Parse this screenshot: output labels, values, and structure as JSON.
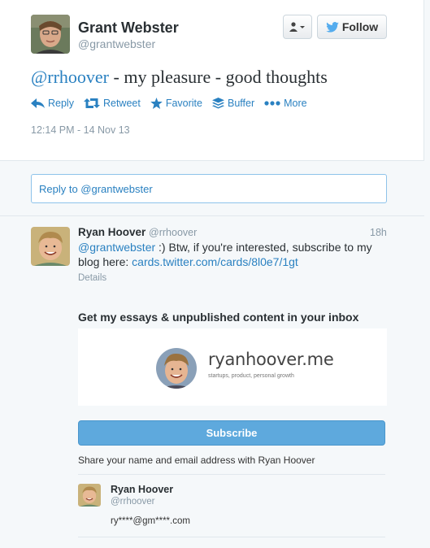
{
  "tweet": {
    "name": "Grant Webster",
    "handle": "@grantwebster",
    "follow_label": "Follow",
    "mention": "@rrhoover",
    "text": " - my pleasure - good thoughts",
    "actions": {
      "reply": "Reply",
      "retweet": "Retweet",
      "favorite": "Favorite",
      "buffer": "Buffer",
      "more": "More"
    },
    "timestamp": "12:14 PM - 14 Nov 13"
  },
  "reply_box": {
    "placeholder": "Reply to @grantwebster"
  },
  "reply_tweet": {
    "name": "Ryan Hoover",
    "handle": "@rrhoover",
    "time": "18h",
    "mention": "@grantwebster",
    "text": " :) Btw, if you're interested, subscribe to my blog here: ",
    "link": "cards.twitter.com/cards/8l0e7/1gt",
    "details": "Details"
  },
  "card": {
    "title": "Get my essays & unpublished content in your inbox",
    "site": "ryanhoover.me",
    "tagline": "startups, product, personal growth",
    "subscribe_label": "Subscribe",
    "share_text": "Share your name and email address with Ryan Hoover",
    "share_name": "Ryan Hoover",
    "share_handle": "@rrhoover",
    "share_email": "ry****@gm****.com"
  },
  "colors": {
    "link": "#2a81c1",
    "subscribe": "#5ea9dd"
  }
}
